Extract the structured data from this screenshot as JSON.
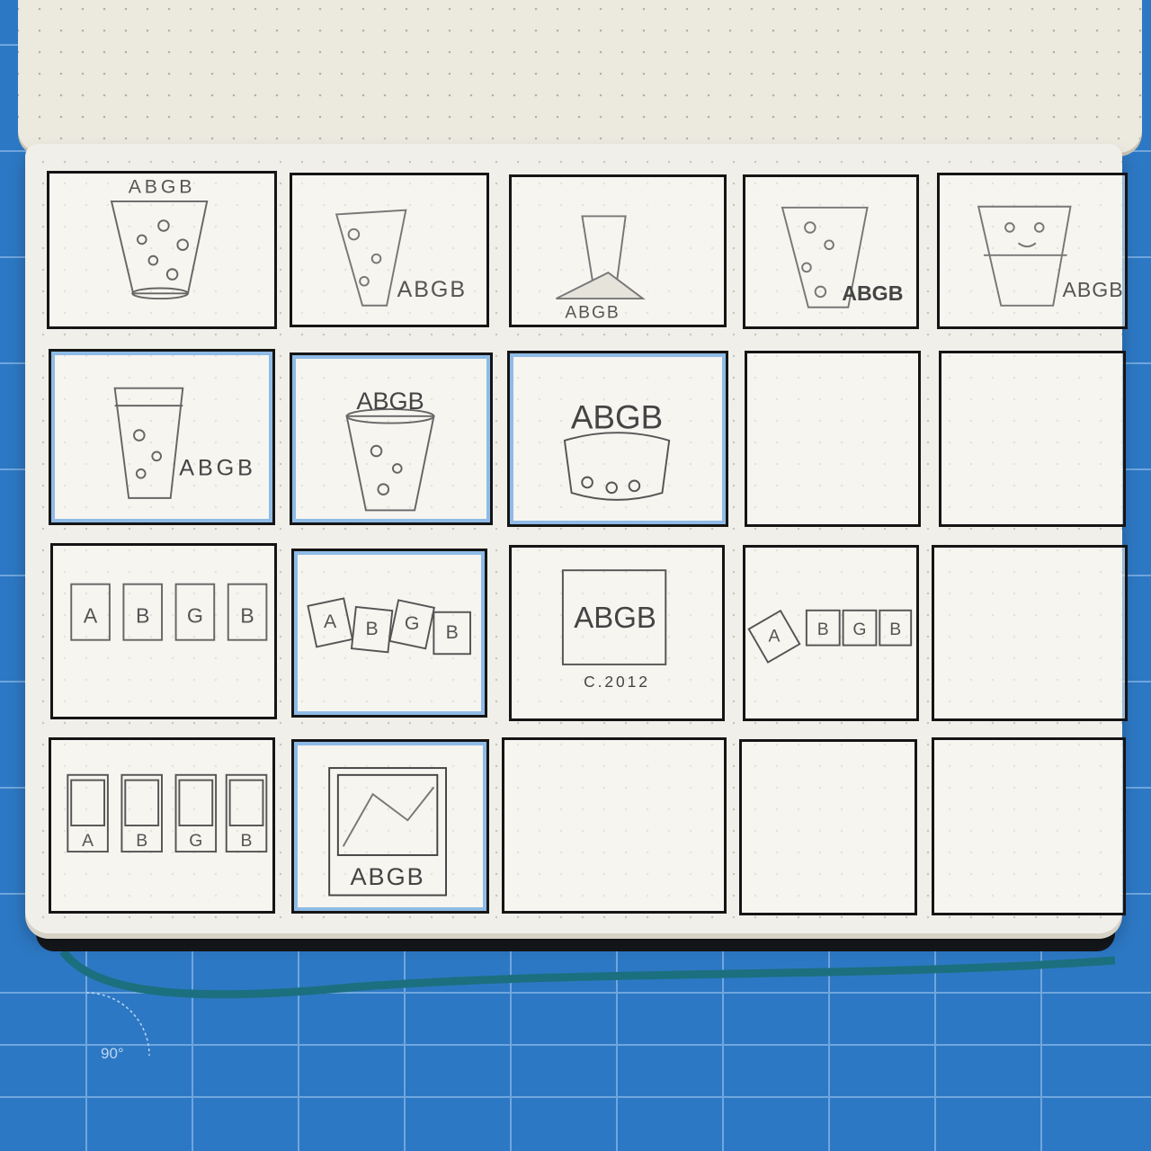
{
  "scene": "notebook sketch grid on cutting mat",
  "colors": {
    "mat": "#2d78c4",
    "paper": "#f1efe9",
    "ink": "#151515",
    "pencil": "#555555",
    "highlight": "#8fbbe6"
  },
  "mat_label": "90°",
  "sketches": [
    {
      "id": "r1c1",
      "label": "ABGB",
      "motif": "glass-letters-top"
    },
    {
      "id": "r1c2",
      "label": "ABGB",
      "motif": "pizza-slice-glass"
    },
    {
      "id": "r1c3",
      "label": "ABGB",
      "motif": "glass-with-slice"
    },
    {
      "id": "r1c4",
      "label": "ABGB",
      "motif": "pizza-glass"
    },
    {
      "id": "r1c5",
      "label": "ABGB",
      "motif": "pizza-face-glass"
    },
    {
      "id": "r2c1",
      "label": "ABGB",
      "motif": "pint-glass",
      "highlighted": true
    },
    {
      "id": "r2c2",
      "label": "ABGB",
      "motif": "glass-letters-top",
      "highlighted": true
    },
    {
      "id": "r2c3",
      "label": "ABGB",
      "motif": "bowl-letters-top",
      "highlighted": true
    },
    {
      "id": "r2c4",
      "label": "",
      "motif": "empty"
    },
    {
      "id": "r2c5",
      "label": "",
      "motif": "empty"
    },
    {
      "id": "r3c1",
      "label": "ABGB",
      "motif": "four-tiles"
    },
    {
      "id": "r3c2",
      "label": "ABGB",
      "motif": "tilted-tiles",
      "highlighted": true
    },
    {
      "id": "r3c3",
      "label": "ABGB",
      "sublabel": "C.2012",
      "motif": "framed-letters"
    },
    {
      "id": "r3c4",
      "label": "ABGB",
      "motif": "falling-tiles"
    },
    {
      "id": "r3c5",
      "label": "",
      "motif": "empty"
    },
    {
      "id": "r4c1",
      "label": "ABGB",
      "motif": "icon-tiles"
    },
    {
      "id": "r4c2",
      "label": "ABGB",
      "motif": "photo-frame",
      "highlighted": true
    },
    {
      "id": "r4c3",
      "label": "",
      "motif": "empty"
    },
    {
      "id": "r4c4",
      "label": "",
      "motif": "empty"
    },
    {
      "id": "r4c5",
      "label": "",
      "motif": "empty"
    }
  ]
}
